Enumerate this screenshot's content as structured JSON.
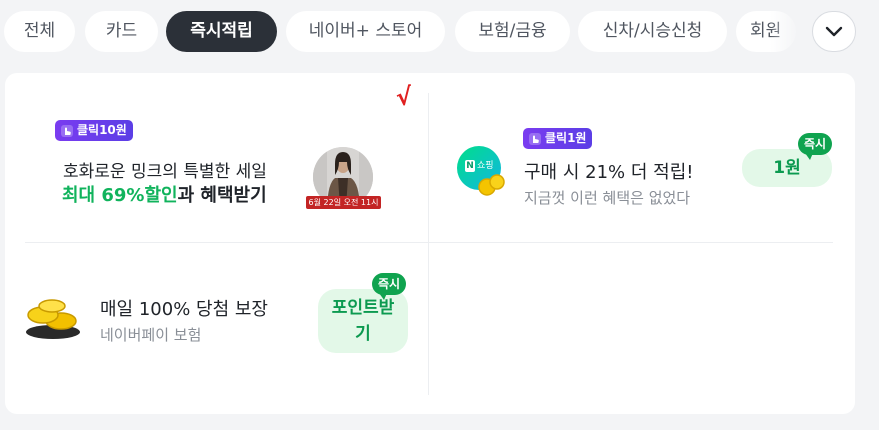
{
  "tabs": [
    {
      "label": "전체",
      "active": false
    },
    {
      "label": "카드",
      "active": false
    },
    {
      "label": "즉시적립",
      "active": true
    },
    {
      "label": "네이버+ 스토어",
      "active": false
    },
    {
      "label": "보험/금융",
      "active": false
    },
    {
      "label": "신차/시승신청",
      "active": false
    },
    {
      "label": "회원",
      "active": false
    }
  ],
  "more_icon": "chevron-down-icon",
  "offers": [
    {
      "badge": "클릭10원",
      "title": "호화로운 밍크의 특별한 세일",
      "highlight": "최대 69%할인",
      "title2_rest": "과 혜택받기",
      "image_caption": "6월 22일 오전 11시",
      "mark": "√"
    },
    {
      "badge": "클릭1원",
      "logo_text": "쇼핑",
      "logo_n": "N",
      "title": "구매 시 21% 더 적립!",
      "subtitle": "지금껏 이런 혜택은 없었다",
      "reward": "1원",
      "instant": "즉시"
    },
    {
      "title": "매일 100% 당첨 보장",
      "subtitle": "네이버페이 보험",
      "reward_line1": "포인트받",
      "reward_line2": "기",
      "instant": "즉시"
    }
  ],
  "colors": {
    "accent_green": "#10b35c",
    "badge_purple": "#6a3cf0",
    "active_tab": "#2b3038"
  }
}
